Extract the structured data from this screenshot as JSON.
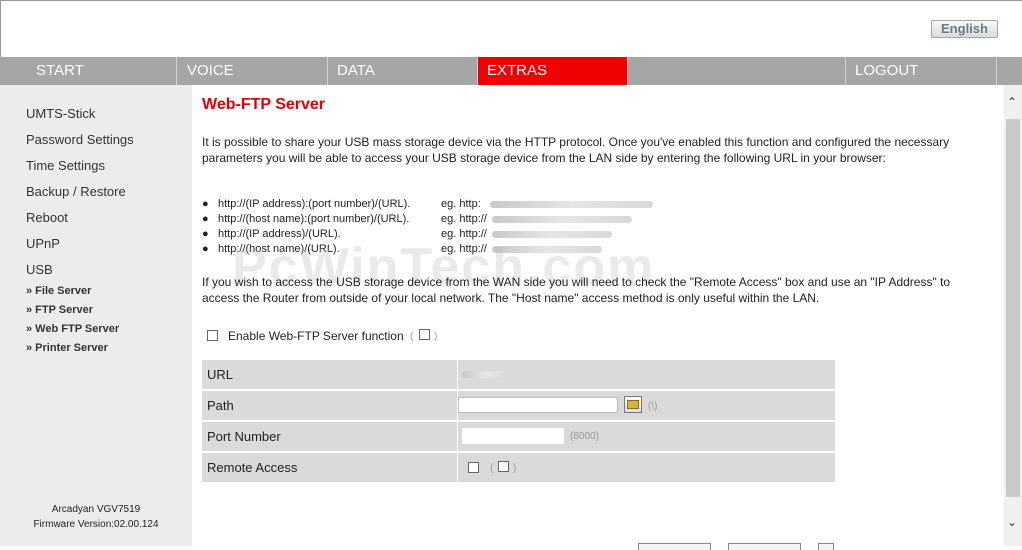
{
  "header": {
    "language_button": "English"
  },
  "nav": {
    "items": [
      {
        "label": "START"
      },
      {
        "label": "VOICE"
      },
      {
        "label": "DATA"
      },
      {
        "label": "EXTRAS"
      },
      {
        "label": ""
      },
      {
        "label": "LOGOUT"
      }
    ],
    "active": "EXTRAS",
    "active_color": "#f00000"
  },
  "sidebar": {
    "items": [
      {
        "label": "UMTS-Stick"
      },
      {
        "label": "Password Settings"
      },
      {
        "label": "Time Settings"
      },
      {
        "label": "Backup / Restore"
      },
      {
        "label": "Reboot"
      },
      {
        "label": "UPnP"
      },
      {
        "label": "USB"
      }
    ],
    "subitems": [
      {
        "label": "» File Server"
      },
      {
        "label": "» FTP Server"
      },
      {
        "label": "» Web FTP Server"
      },
      {
        "label": "» Printer Server"
      }
    ],
    "footer": {
      "model": "Arcadyan VGV7519",
      "firmware": "Firmware Version:02.00.124"
    }
  },
  "main": {
    "title": "Web-FTP Server",
    "intro": "It is possible to share your USB mass storage device via the HTTP protocol. Once you've enabled this function and configured the necessary parameters you will be able to access your USB storage device from the LAN side by entering the following URL in your browser:",
    "bullets": [
      {
        "format": "http://(IP address):(port number)/(URL).",
        "example": "eg. http:"
      },
      {
        "format": "http://(host name):(port number)/(URL).",
        "example": "eg. http://"
      },
      {
        "format": "http://(IP address)/(URL).",
        "example": "eg. http://"
      },
      {
        "format": "http://(host name)/(URL).",
        "example": "eg. http://"
      }
    ],
    "wan_note": "If you wish to access the USB storage device from the WAN side you will need to check the \"Remote Access\" box and use an \"IP Address\" to access the Router from outside of your local network. The \"Host name\" access method is only useful within the LAN.",
    "enable_label": "Enable Web-FTP Server function",
    "watermark": "PcWinTech.com",
    "form": {
      "rows": [
        {
          "label": "URL"
        },
        {
          "label": "Path",
          "hint": "(\\)"
        },
        {
          "label": "Port Number",
          "hint": "(8000)"
        },
        {
          "label": "Remote Access"
        }
      ]
    }
  }
}
